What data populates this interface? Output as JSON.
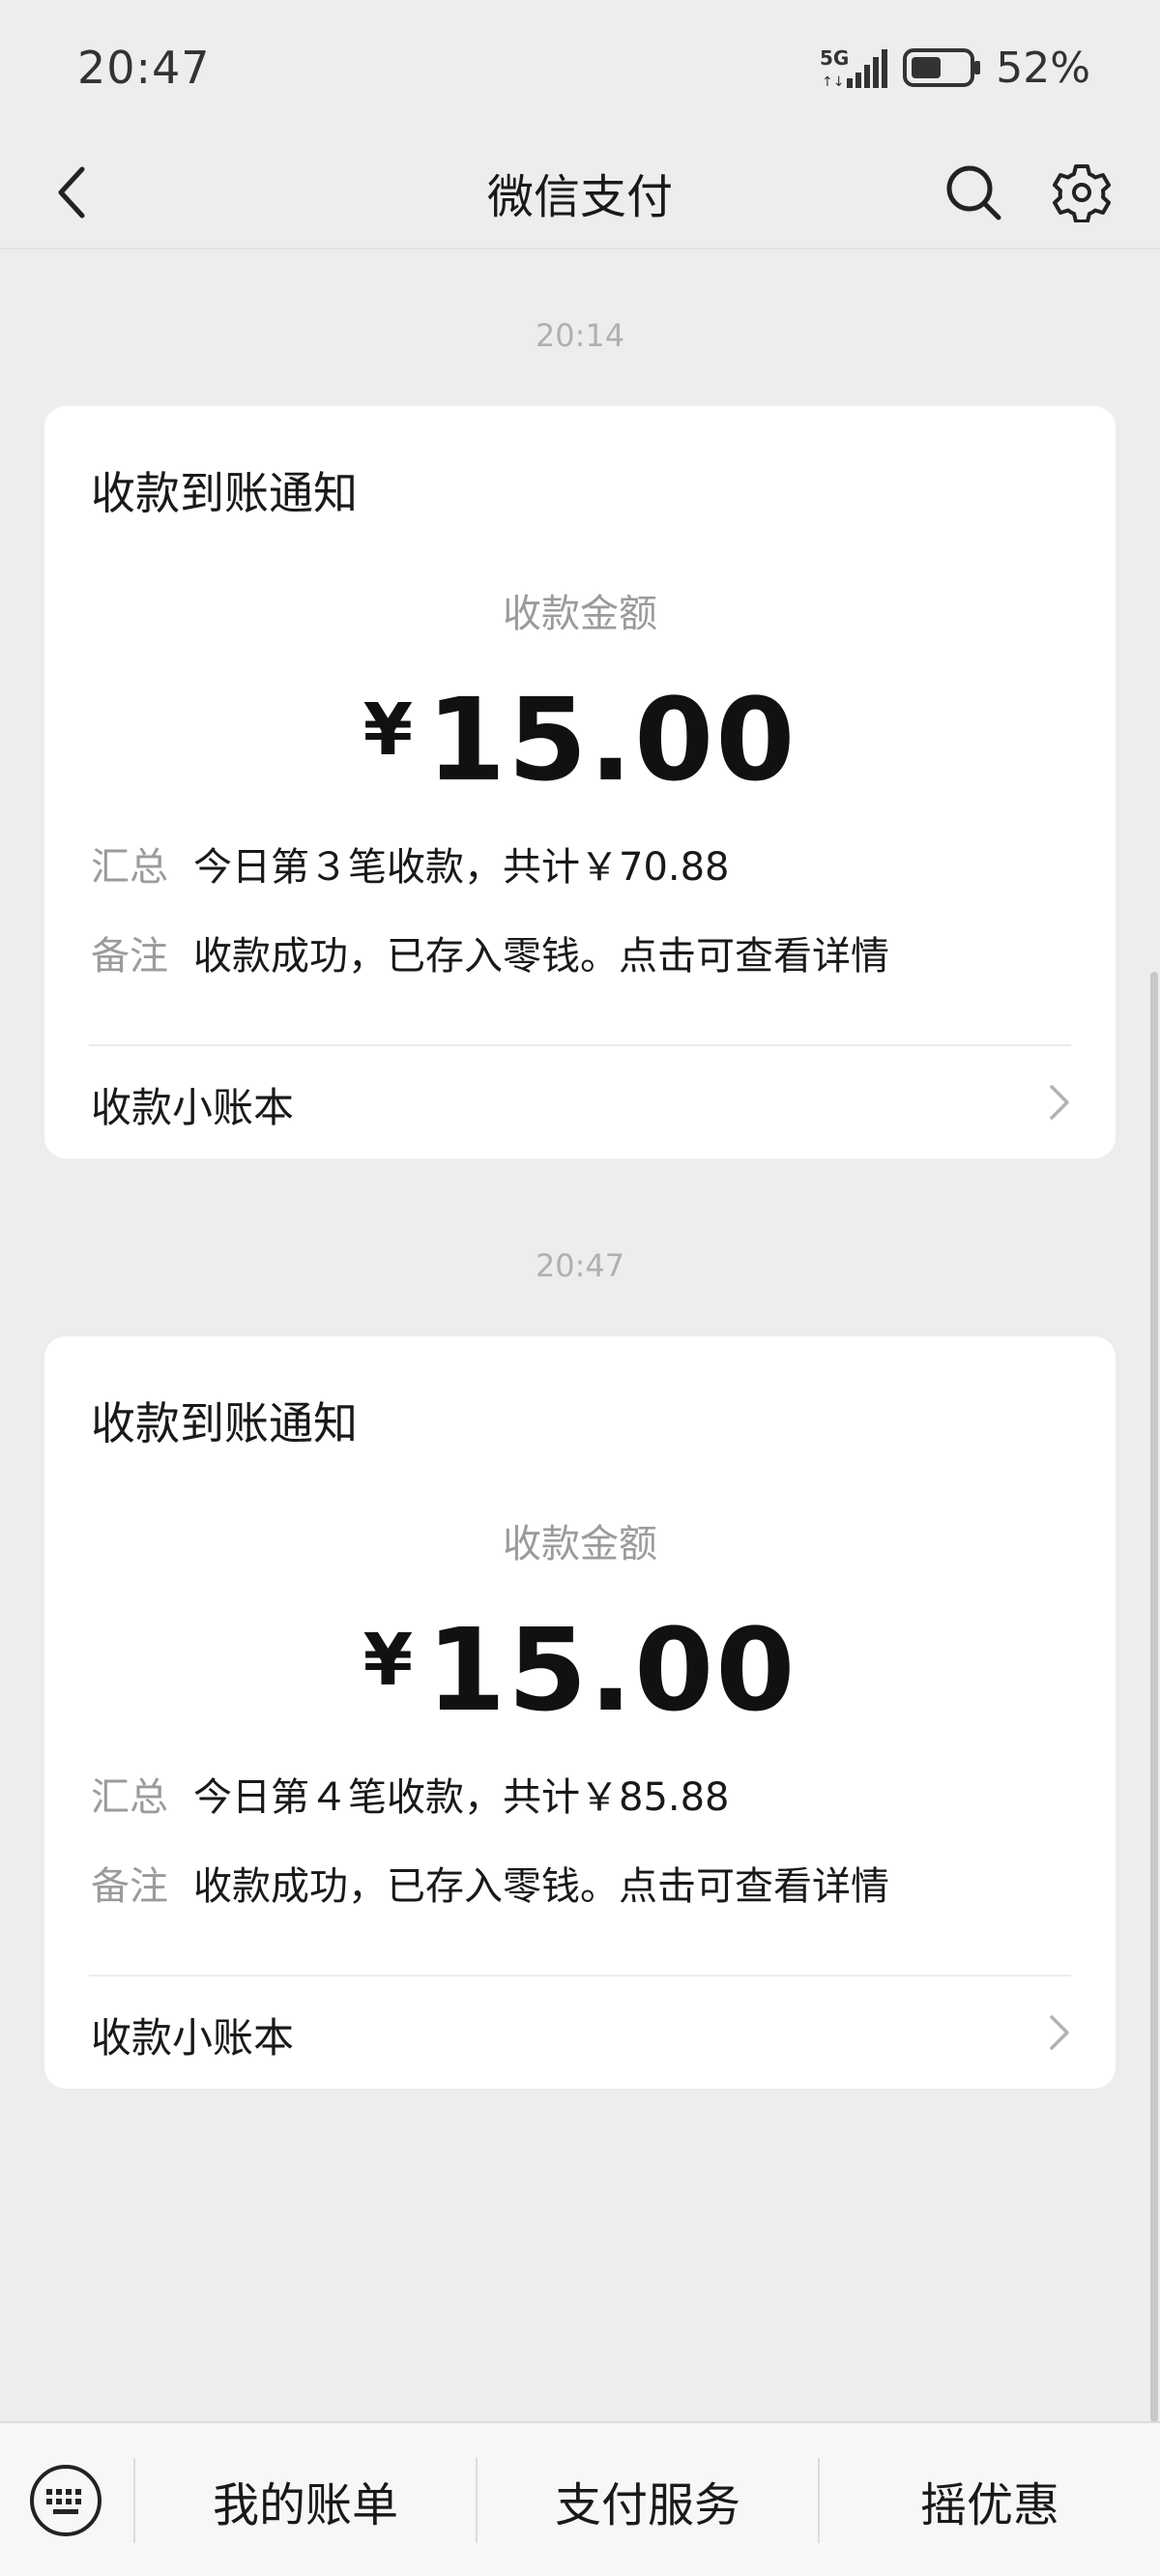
{
  "status_bar": {
    "time": "20:47",
    "network": "5G",
    "battery_percent": "52%",
    "battery_level": 0.52
  },
  "nav": {
    "title": "微信支付",
    "back_icon": "chevron-left-icon",
    "search_icon": "search-icon",
    "settings_icon": "gear-icon"
  },
  "messages": [
    {
      "timestamp": "20:14",
      "card_title": "收款到账通知",
      "amount_label": "收款金额",
      "currency": "¥",
      "amount": "15.00",
      "summary_key": "汇总",
      "summary_value": "今日第３笔收款，共计￥70.88",
      "remark_key": "备注",
      "remark_value": "收款成功，已存入零钱。点击可查看详情",
      "ledger_label": "收款小账本"
    },
    {
      "timestamp": "20:47",
      "card_title": "收款到账通知",
      "amount_label": "收款金额",
      "currency": "¥",
      "amount": "15.00",
      "summary_key": "汇总",
      "summary_value": "今日第４笔收款，共计￥85.88",
      "remark_key": "备注",
      "remark_value": "收款成功，已存入零钱。点击可查看详情",
      "ledger_label": "收款小账本"
    }
  ],
  "bottom_menu": {
    "keyboard_icon": "keyboard-icon",
    "items": [
      {
        "label": "我的账单"
      },
      {
        "label": "支付服务"
      },
      {
        "label": "摇优惠"
      }
    ]
  },
  "colors": {
    "background": "#ededed",
    "card": "#ffffff",
    "muted_text": "#9b9b9b",
    "primary_text": "#191919"
  }
}
